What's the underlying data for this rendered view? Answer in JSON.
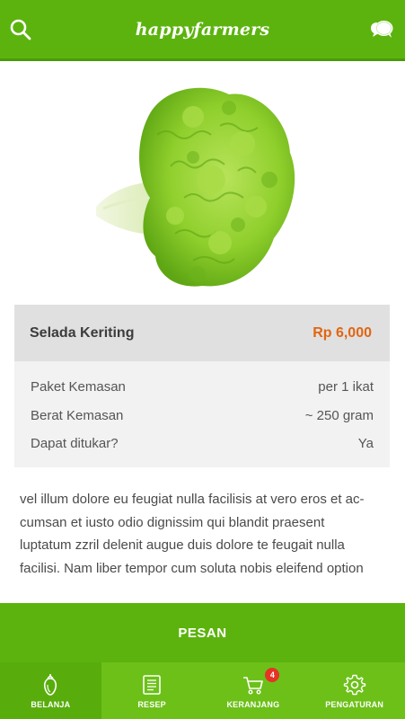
{
  "header": {
    "brand": "happyfarmers",
    "search_icon": "search-icon",
    "chat_icon": "chat-bubbles-icon"
  },
  "colors": {
    "primary_green": "#5cb30e",
    "nav_green": "#6cc018",
    "price_orange": "#e26512",
    "badge_red": "#e53326"
  },
  "product": {
    "name": "Selada Keriting",
    "price": "Rp 6,000",
    "image_icon": "lettuce-image",
    "details": [
      {
        "label": "Paket Kemasan",
        "value": "per 1 ikat"
      },
      {
        "label": "Berat Kemasan",
        "value": "~ 250 gram"
      },
      {
        "label": "Dapat ditukar?",
        "value": "Ya"
      }
    ],
    "description_lines": [
      "vel illum dolore eu feugiat nulla facilisis at vero eros et ac-",
      "cumsan et iusto odio dignissim qui blandit praesent",
      "luptatum zzril delenit augue duis dolore te feugait nulla",
      "facilisi. Nam liber tempor cum soluta nobis eleifend option"
    ]
  },
  "order_button": {
    "label": "PESAN"
  },
  "bottom_nav": {
    "items": [
      {
        "label": "BELANJA",
        "icon": "eggplant-icon",
        "active": true
      },
      {
        "label": "RESEP",
        "icon": "recipe-book-icon",
        "active": false
      },
      {
        "label": "KERANJANG",
        "icon": "cart-icon",
        "active": false,
        "badge": "4"
      },
      {
        "label": "PENGATURAN",
        "icon": "gear-icon",
        "active": false
      }
    ]
  }
}
